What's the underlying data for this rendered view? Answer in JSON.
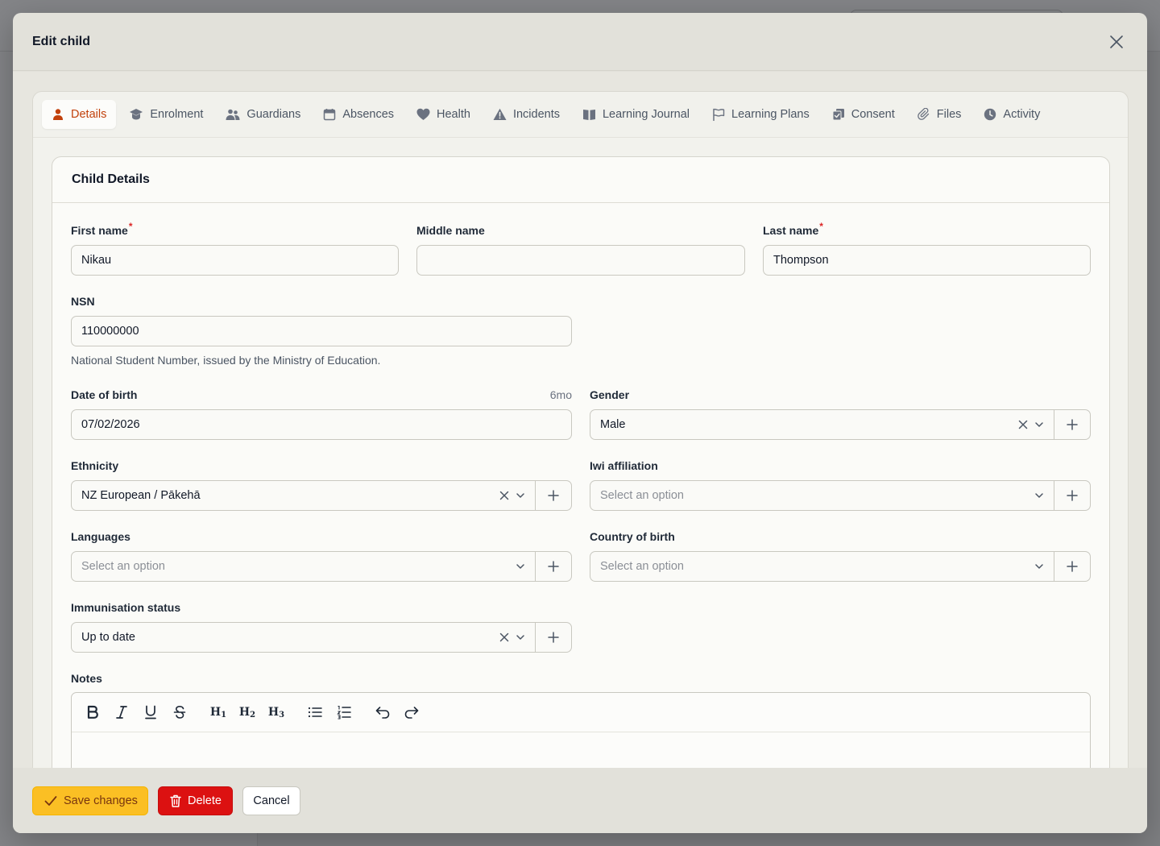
{
  "modal": {
    "title": "Edit child"
  },
  "tabs": [
    {
      "label": "Details",
      "icon": "person-icon",
      "active": true
    },
    {
      "label": "Enrolment",
      "icon": "graduation-cap-icon"
    },
    {
      "label": "Guardians",
      "icon": "users-icon"
    },
    {
      "label": "Absences",
      "icon": "calendar-icon"
    },
    {
      "label": "Health",
      "icon": "heart-icon"
    },
    {
      "label": "Incidents",
      "icon": "warning-icon"
    },
    {
      "label": "Learning Journal",
      "icon": "book-icon"
    },
    {
      "label": "Learning Plans",
      "icon": "flag-icon"
    },
    {
      "label": "Consent",
      "icon": "document-check-icon"
    },
    {
      "label": "Files",
      "icon": "paperclip-icon"
    },
    {
      "label": "Activity",
      "icon": "clock-icon"
    }
  ],
  "card": {
    "title": "Child Details"
  },
  "form": {
    "first_name": {
      "label": "First name",
      "required_mark": "*",
      "value": "Nikau"
    },
    "middle_name": {
      "label": "Middle name",
      "value": ""
    },
    "last_name": {
      "label": "Last name",
      "required_mark": "*",
      "value": "Thompson"
    },
    "nsn": {
      "label": "NSN",
      "value": "110000000",
      "hint": "National Student Number, issued by the Ministry of Education."
    },
    "dob": {
      "label": "Date of birth",
      "age": "6mo",
      "value": "07/02/2026"
    },
    "gender": {
      "label": "Gender",
      "value": "Male"
    },
    "ethnicity": {
      "label": "Ethnicity",
      "value": "NZ European / Pākehā"
    },
    "iwi": {
      "label": "Iwi affiliation",
      "placeholder": "Select an option"
    },
    "languages": {
      "label": "Languages",
      "placeholder": "Select an option"
    },
    "country": {
      "label": "Country of birth",
      "placeholder": "Select an option"
    },
    "immunisation": {
      "label": "Immunisation status",
      "value": "Up to date"
    },
    "notes": {
      "label": "Notes"
    }
  },
  "footer": {
    "save_label": "Save changes",
    "delete_label": "Delete",
    "cancel_label": "Cancel"
  },
  "colors": {
    "accent": "#c2410c",
    "save": "#fbbf24",
    "delete": "#dc1111",
    "required": "#dc2626"
  }
}
